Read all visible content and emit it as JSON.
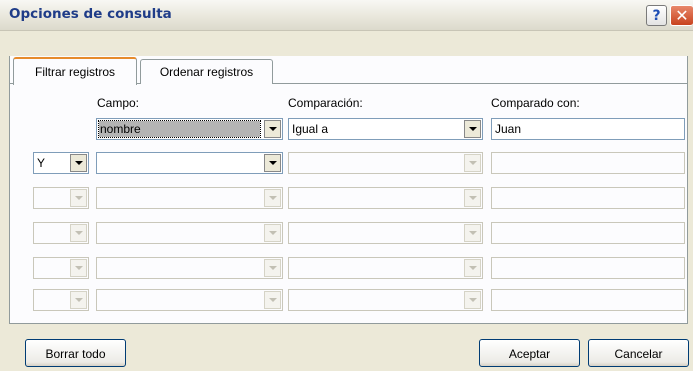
{
  "window": {
    "title": "Opciones de consulta",
    "help": "?",
    "close": "✕"
  },
  "tabs": [
    {
      "label": "Filtrar registros"
    },
    {
      "label": "Ordenar registros"
    }
  ],
  "headers": {
    "campo": "Campo:",
    "comparacion": "Comparación:",
    "comparado_con": "Comparado con:"
  },
  "rows": [
    {
      "connector": "",
      "field": "nombre",
      "comparison": "Igual a",
      "value": "Juan",
      "enabled": true
    },
    {
      "connector": "Y",
      "field": "",
      "comparison": "",
      "value": "",
      "enabled": true
    },
    {
      "connector": "",
      "field": "",
      "comparison": "",
      "value": "",
      "enabled": false
    },
    {
      "connector": "",
      "field": "",
      "comparison": "",
      "value": "",
      "enabled": false
    },
    {
      "connector": "",
      "field": "",
      "comparison": "",
      "value": "",
      "enabled": false
    },
    {
      "connector": "",
      "field": "",
      "comparison": "",
      "value": "",
      "enabled": false
    }
  ],
  "buttons": {
    "clear": "Borrar todo",
    "ok": "Aceptar",
    "cancel": "Cancelar"
  }
}
